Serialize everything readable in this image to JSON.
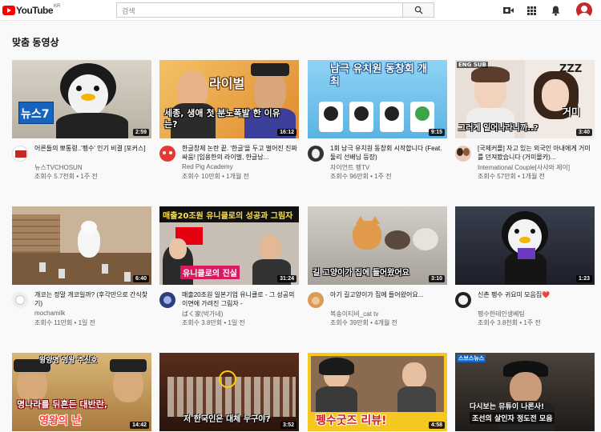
{
  "header": {
    "logo_text": "YouTube",
    "logo_region": "KR",
    "search_placeholder": "검색"
  },
  "section": {
    "title": "맞춤 동영상"
  },
  "videos": [
    {
      "title": "어른들의 뽀통령..'펭수' 인기 비결 [포커스]",
      "channel": "뉴스TVCHOSUN",
      "stats": "조회수 5.7천회 • 1주 전",
      "duration": "2:59",
      "thumb_text": "뉴스7"
    },
    {
      "title": "한글창제 논란 끝. '한글'을 두고 벌어진 진짜 싸움! [임용한의 라이벌, 한글남...",
      "channel": "Red Pig Academy",
      "stats": "조회수 10만회 • 1개월 전",
      "duration": "16:12",
      "thumb_text": "라이벌",
      "thumb_sub": "세종, 생애 첫 분노폭발 한 이유는?"
    },
    {
      "title": "1회 남극 유치원 동창회 시작합니다 (Feat. 둘리 선배님 등장)",
      "channel": "자이언트 펭TV",
      "stats": "조회수 96만회 • 1주 전",
      "duration": "9:15",
      "thumb_text": "남극 유치원 동창회 개최"
    },
    {
      "title": "[국제커플] 자고 있는 외국인 아내에게 거미를 던져봤습니다 (거미몰카)...",
      "channel": "International Couple[사샤와 제이]",
      "stats": "조회수 57만회 • 1개월 전",
      "duration": "3:40",
      "thumb_text": "그러게 일어나라니까..?",
      "thumb_sub": "거미",
      "thumb_tag": "ENG SUB"
    },
    {
      "title": "개코는 정말 개코일까? (후각만으로 간식찾기)",
      "channel": "mochamilk",
      "stats": "조회수 11만회 • 1일 전",
      "duration": "6:40"
    },
    {
      "title": "매출20조원 일본기업 유니클로 - 그 성공의 이면에 가려진 그림자 -",
      "channel": "ばく家(박가네)",
      "stats": "조회수 3.8만회 • 1일 전",
      "duration": "31:24",
      "thumb_text": "매출20조원 유니클로의 성공과 그림자",
      "thumb_sub": "유니클로의 진실"
    },
    {
      "title": "아기 길고양이가 집에 들어왔어요...",
      "channel": "복송이티비_cat tv",
      "stats": "조회수 39만회 • 4개월 전",
      "duration": "3:10",
      "thumb_text": "길 고양이가 집에 들어왔어요"
    },
    {
      "title": "신촌 펭수 귀요미 모음집❤️",
      "channel": "펭수한테인생베팅",
      "stats": "조회수 3.8천회 • 1주 전",
      "duration": "1:23"
    },
    {
      "duration": "14:42",
      "thumb_text": "명나라를 뒤흔든 대반란,",
      "thumb_sub": "영왕의 난",
      "thumb_top": "왕양명 영왕 주신호"
    },
    {
      "duration": "3:52",
      "thumb_text": "저 한국인은 대체 누구야?"
    },
    {
      "duration": "4:58",
      "thumb_text": "펭수굿즈 리뷰!"
    },
    {
      "duration": "",
      "thumb_text": "다시보는 뮤튜이 나론사!",
      "thumb_sub": "조선의 살인자 정도전 모음"
    }
  ],
  "colors": {
    "brand_red": "#ff0000",
    "text_primary": "#0f0f0f",
    "text_secondary": "#606060"
  }
}
